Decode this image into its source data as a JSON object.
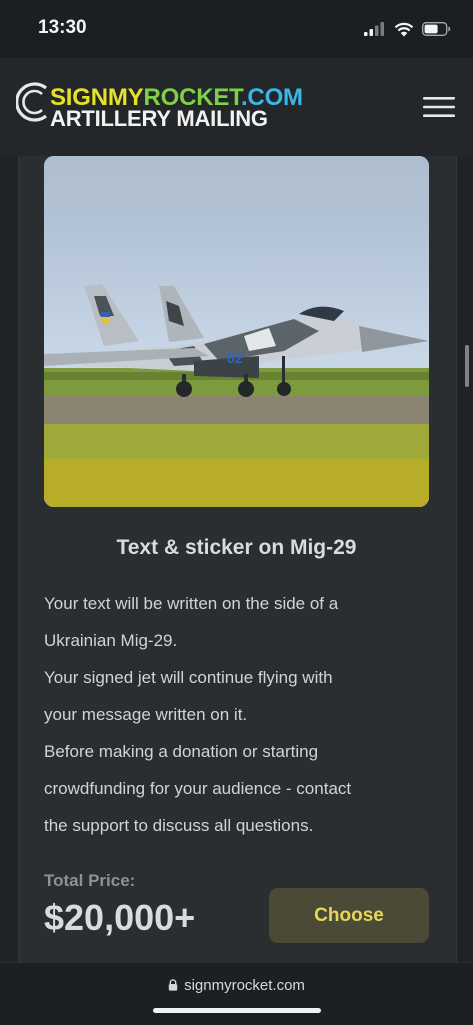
{
  "status": {
    "time": "13:30",
    "icons": [
      "cellular-signal-icon",
      "wifi-icon",
      "battery-icon"
    ]
  },
  "header": {
    "logo_line1_parts": [
      "SIGNMY",
      "ROCKET",
      ".COM"
    ],
    "logo_line2": "ARTILLERY MAILING",
    "menu_icon": "hamburger-menu-icon"
  },
  "product": {
    "image_icon": "mig-29-jet-photo",
    "aircraft_marking": "02",
    "title": "Text & sticker on Mig-29",
    "description": [
      "Your text will be written on the side of a",
      "Ukrainian Mig-29.",
      "Your signed jet will continue flying with",
      "your message written on it.",
      "Before making a donation or starting",
      "crowdfunding for your audience - contact",
      "the support to discuss all questions."
    ],
    "price_label": "Total Price:",
    "price_value": "$20,000+",
    "choose_label": "Choose"
  },
  "browser": {
    "url": "signmyrocket.com"
  },
  "colors": {
    "background": "#1f2226",
    "card": "#2b2e31",
    "button_bg": "#4b4a36",
    "button_text": "#e7d65a",
    "logo_yellow": "#e5e229",
    "logo_green": "#7ed04b",
    "logo_cyan": "#3bb6e8"
  }
}
